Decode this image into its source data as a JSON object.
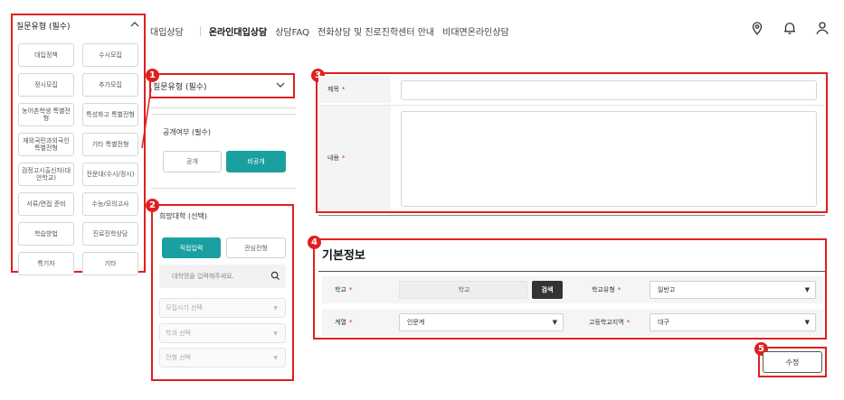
{
  "nav": {
    "items": [
      "대입상담",
      "온라인대입상담",
      "상담FAQ",
      "전화상담 및 진로진학센터 안내",
      "비대면온라인상담"
    ],
    "active_index": 1
  },
  "top_icons": [
    "location-icon",
    "bell-icon",
    "user-icon"
  ],
  "category_panel": {
    "title": "질문유형 (필수)",
    "items": [
      "대입정책",
      "수시모집",
      "정시모집",
      "추가모집",
      "농어촌학생 특별전형",
      "특성화고 특별전형",
      "재외국민과외국인 특별전형",
      "기타 특별전형",
      "검정고시출신자(대안학교)",
      "전문대(수시/정시)",
      "서류/면접 준비",
      "수능/모의고사",
      "학습방법",
      "진로진학상담",
      "특기자",
      "기타"
    ]
  },
  "question_type_dropdown": {
    "label": "질문유형 (필수)"
  },
  "visibility": {
    "label": "공개여부 (필수)",
    "public": "공개",
    "private": "비공개",
    "selected": "비공개"
  },
  "university": {
    "label": "희망대학 (선택)",
    "tab_direct": "직접입력",
    "tab_interest": "관심전형",
    "search_placeholder": "대학명을 입력해주세요.",
    "select_period": "모집시기 선택",
    "select_department": "학과 선택",
    "select_admission": "전형 선택"
  },
  "form": {
    "title_label": "제목",
    "content_label": "내용",
    "required_mark": "*"
  },
  "basic_info": {
    "section_title": "기본정보",
    "school_label": "학교",
    "school_value": "학교",
    "search_button": "검색",
    "school_type_label": "학교유형",
    "school_type_value": "일반고",
    "track_label": "계열",
    "track_value": "인문계",
    "region_label": "고등학교지역",
    "region_value": "대구"
  },
  "edit_button": "수정",
  "badges": [
    "1",
    "2",
    "3",
    "4",
    "5"
  ],
  "colors": {
    "highlight_red": "#e02020",
    "teal": "#1aa0a0",
    "dark_button": "#333333"
  }
}
